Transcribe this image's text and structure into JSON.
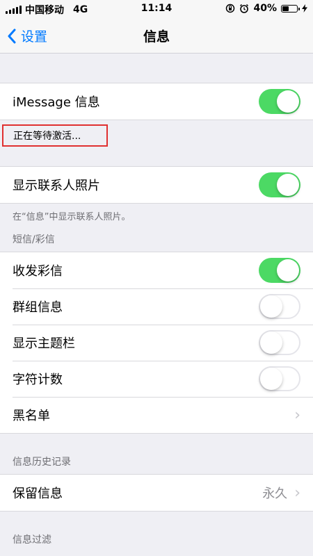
{
  "status_bar": {
    "carrier": "中国移动",
    "network": "4G",
    "time": "11:14",
    "battery": "40%",
    "battery_level": 0.4
  },
  "nav": {
    "back_label": "设置",
    "title": "信息"
  },
  "imessage": {
    "label": "iMessage 信息",
    "on": true,
    "status": "正在等待激活..."
  },
  "contact_photos": {
    "label": "显示联系人照片",
    "on": true,
    "footer": "在“信息”中显示联系人照片。"
  },
  "sms_section": {
    "header": "短信/彩信",
    "rows": [
      {
        "label": "收发彩信",
        "on": true
      },
      {
        "label": "群组信息",
        "on": false
      },
      {
        "label": "显示主题栏",
        "on": false
      },
      {
        "label": "字符计数",
        "on": false
      }
    ],
    "blocked_label": "黑名单"
  },
  "history_section": {
    "header": "信息历史记录",
    "keep_label": "保留信息",
    "keep_value": "永久"
  },
  "filter_section": {
    "header": "信息过滤"
  },
  "colors": {
    "accent": "#007aff",
    "toggle_on": "#4cd964",
    "highlight": "#e03030"
  }
}
